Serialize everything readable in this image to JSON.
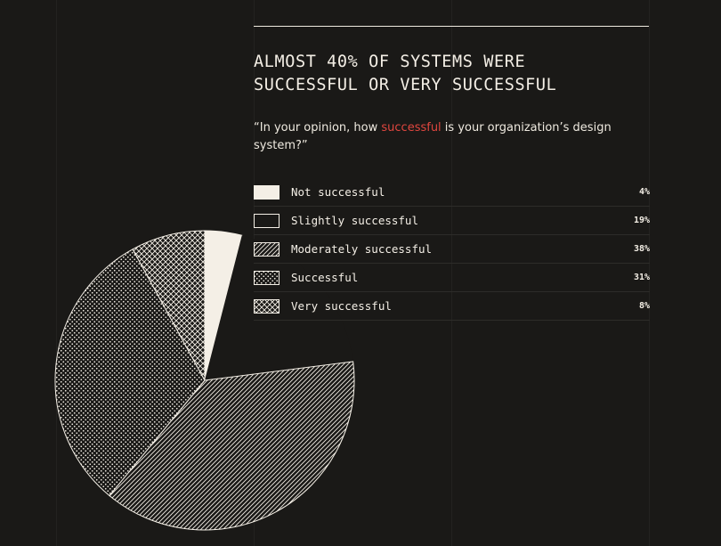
{
  "title_lines": [
    "ALMOST 40% OF SYSTEMS WERE",
    "SUCCESSFUL OR VERY SUCCESSFUL"
  ],
  "question": {
    "before": "“In your opinion, how ",
    "highlight": "successful",
    "after": " is your organization’s design system?”"
  },
  "colors": {
    "background": "#1a1917",
    "foreground": "#f4efe6",
    "highlight": "#e0463f"
  },
  "chart_data": {
    "type": "pie",
    "categories": [
      "Not successful",
      "Slightly successful",
      "Moderately successful",
      "Successful",
      "Very successful"
    ],
    "values": [
      4,
      19,
      38,
      31,
      8
    ],
    "value_labels": [
      "4%",
      "19%",
      "38%",
      "31%",
      "8%"
    ],
    "fills": [
      "solid",
      "empty",
      "diagonal-lines",
      "dots",
      "crosshatch"
    ],
    "legend_placement": "right"
  }
}
